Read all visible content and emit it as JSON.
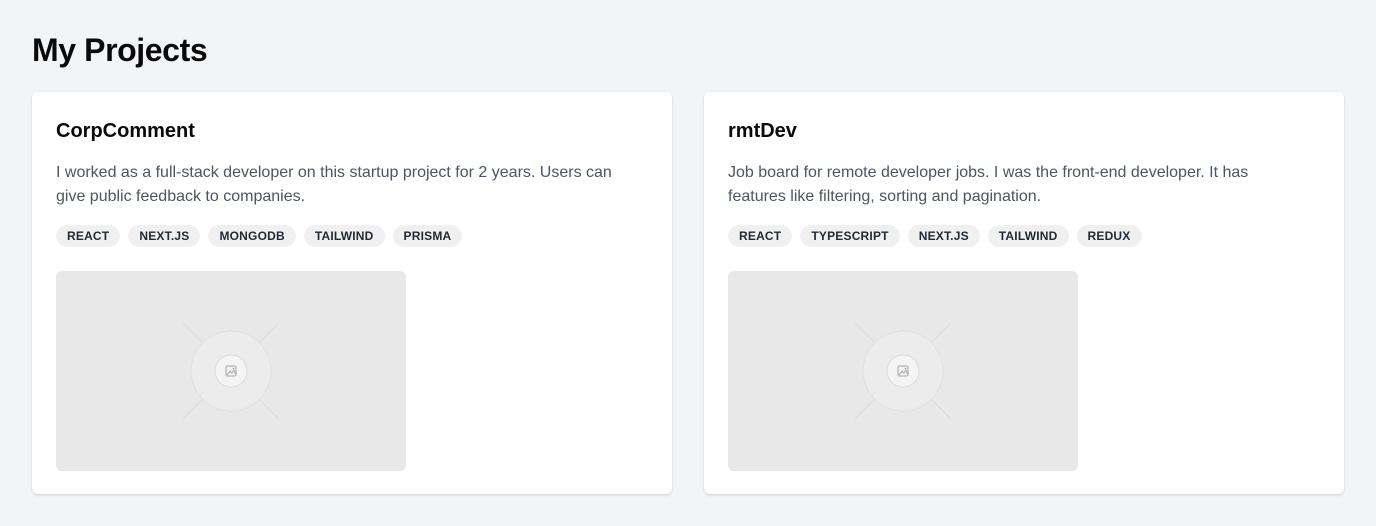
{
  "page": {
    "title": "My Projects"
  },
  "projects": [
    {
      "title": "CorpComment",
      "description": "I worked as a full-stack developer on this startup project for 2 years. Users can give public feedback to companies.",
      "tags": [
        "REACT",
        "NEXT.JS",
        "MONGODB",
        "TAILWIND",
        "PRISMA"
      ],
      "image_icon": "image-placeholder-icon"
    },
    {
      "title": "rmtDev",
      "description": "Job board for remote developer jobs. I was the front-end developer. It has features like filtering, sorting and pagination.",
      "tags": [
        "REACT",
        "TYPESCRIPT",
        "NEXT.JS",
        "TAILWIND",
        "REDUX"
      ],
      "image_icon": "image-placeholder-icon"
    }
  ],
  "colors": {
    "background": "#f3f4f6",
    "card": "#ffffff",
    "tag_background": "#f0f0f0",
    "description_text": "#4b5563",
    "placeholder": "#e8e8e8"
  }
}
